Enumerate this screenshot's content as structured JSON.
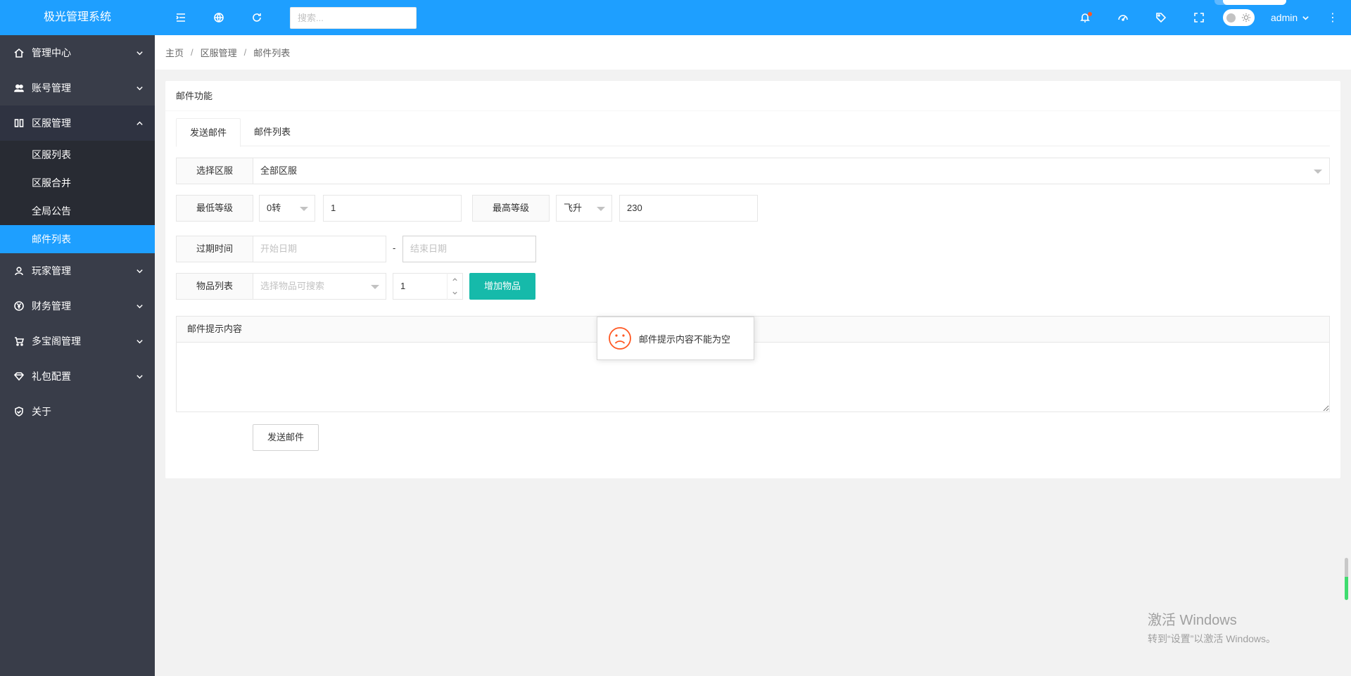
{
  "app": {
    "title": "极光管理系统"
  },
  "topbar": {
    "search_placeholder": "搜索...",
    "user": "admin",
    "icons": [
      "menu-fold-icon",
      "globe-icon",
      "refresh-icon",
      "bell-icon",
      "dashboard-icon",
      "tag-icon",
      "fullscreen-icon",
      "theme-toggle",
      "more-vertical-icon"
    ]
  },
  "sidebar": {
    "items": [
      {
        "label": "管理中心",
        "icon": "home-icon"
      },
      {
        "label": "账号管理",
        "icon": "users-icon"
      },
      {
        "label": "区服管理",
        "icon": "columns-icon",
        "expanded": true,
        "children": [
          {
            "label": "区服列表"
          },
          {
            "label": "区服合并"
          },
          {
            "label": "全局公告"
          },
          {
            "label": "邮件列表",
            "active": true
          }
        ]
      },
      {
        "label": "玩家管理",
        "icon": "user-icon"
      },
      {
        "label": "财务管理",
        "icon": "yen-icon"
      },
      {
        "label": "多宝阁管理",
        "icon": "cart-icon"
      },
      {
        "label": "礼包配置",
        "icon": "diamond-icon"
      },
      {
        "label": "关于",
        "icon": "shield-icon"
      }
    ]
  },
  "breadcrumb": [
    "主页",
    "区服管理",
    "邮件列表"
  ],
  "card": {
    "title": "邮件功能",
    "tabs": [
      "发送邮件",
      "邮件列表"
    ],
    "active_tab": 0,
    "form": {
      "server_label": "选择区服",
      "server_value": "全部区服",
      "min_level_label": "最低等级",
      "min_level_rebirth": "0转",
      "min_level_value": "1",
      "max_level_label": "最高等级",
      "max_level_rebirth": "飞升",
      "max_level_value": "230",
      "expire_label": "过期时间",
      "start_date_placeholder": "开始日期",
      "date_sep": "-",
      "end_date_placeholder": "结束日期",
      "items_label": "物品列表",
      "items_placeholder": "选择物品可搜索",
      "item_quantity": "1",
      "add_item_button": "增加物品",
      "content_label": "邮件提示内容",
      "send_button": "发送邮件"
    }
  },
  "toast": {
    "message": "邮件提示内容不能为空"
  },
  "watermark": {
    "line1": "激活 Windows",
    "line2": "转到“设置”以激活 Windows。"
  },
  "colors": {
    "primary": "#1e9fff",
    "sidebar": "#393d49",
    "teal": "#16baaa",
    "warn": "#ff5722"
  }
}
